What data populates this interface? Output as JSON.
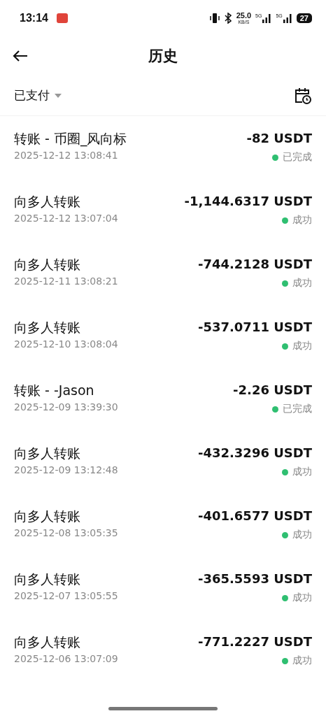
{
  "status_bar": {
    "time": "13:14",
    "speed": "25.0",
    "speed_unit": "KB/S",
    "signal_1": "5G",
    "signal_2": "5G",
    "battery": "27"
  },
  "header": {
    "title": "历史"
  },
  "filter": {
    "label": "已支付"
  },
  "transactions": [
    {
      "title": "转账 - 币圈_风向标",
      "time": "2025-12-12 13:08:41",
      "amount": "-82 USDT",
      "status": "已完成"
    },
    {
      "title": "向多人转账",
      "time": "2025-12-12 13:07:04",
      "amount": "-1,144.6317 USDT",
      "status": "成功"
    },
    {
      "title": "向多人转账",
      "time": "2025-12-11 13:08:21",
      "amount": "-744.2128 USDT",
      "status": "成功"
    },
    {
      "title": "向多人转账",
      "time": "2025-12-10 13:08:04",
      "amount": "-537.0711 USDT",
      "status": "成功"
    },
    {
      "title": "转账 - -Jason",
      "time": "2025-12-09 13:39:30",
      "amount": "-2.26 USDT",
      "status": "已完成"
    },
    {
      "title": "向多人转账",
      "time": "2025-12-09 13:12:48",
      "amount": "-432.3296 USDT",
      "status": "成功"
    },
    {
      "title": "向多人转账",
      "time": "2025-12-08 13:05:35",
      "amount": "-401.6577 USDT",
      "status": "成功"
    },
    {
      "title": "向多人转账",
      "time": "2025-12-07 13:05:55",
      "amount": "-365.5593 USDT",
      "status": "成功"
    },
    {
      "title": "向多人转账",
      "time": "2025-12-06 13:07:09",
      "amount": "-771.2227 USDT",
      "status": "成功"
    }
  ]
}
